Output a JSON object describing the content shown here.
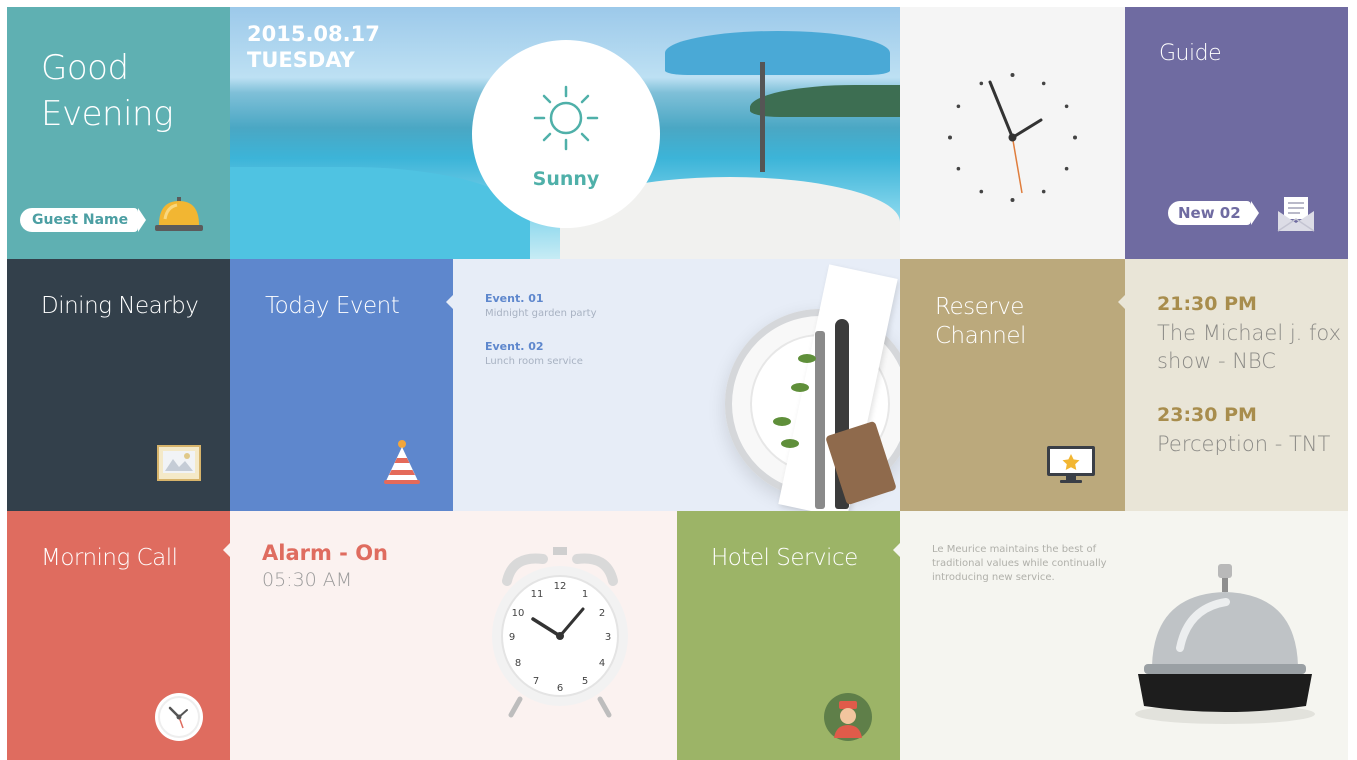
{
  "greeting": {
    "line1": "Good",
    "line2": "Evening",
    "guest_label": "Guest Name",
    "icon": "service-bell-icon"
  },
  "weather": {
    "date": "2015.08.17",
    "day": "TUESDAY",
    "condition": "Sunny",
    "icon": "sun-icon"
  },
  "clock": {
    "icon": "analog-clock-icon"
  },
  "guide": {
    "title": "Guide",
    "new_label": "New 02",
    "icon": "mail-envelope-icon"
  },
  "dining": {
    "title": "Dining Nearby",
    "icon": "map-picture-icon"
  },
  "today_event": {
    "title": "Today Event",
    "icon": "party-hat-icon",
    "events": [
      {
        "label": "Event. 01",
        "desc": "Midnight garden party"
      },
      {
        "label": "Event. 02",
        "desc": "Lunch room service"
      }
    ]
  },
  "reserve": {
    "title_line1": "Reserve",
    "title_line2": "Channel",
    "icon": "tv-star-icon"
  },
  "schedule": [
    {
      "time": "21:30 PM",
      "show": "The Michael j. fox show - NBC"
    },
    {
      "time": "23:30 PM",
      "show": "Perception - TNT"
    }
  ],
  "morning_call": {
    "title": "Morning Call",
    "icon": "wall-clock-icon"
  },
  "alarm": {
    "status": "Alarm - On",
    "time": "05:30 AM"
  },
  "hotel_service": {
    "title": "Hotel Service",
    "icon": "bellboy-icon",
    "description": "Le Meurice maintains the best of traditional values while continually introducing new service."
  },
  "colors": {
    "teal": "#5fb0b2",
    "navy": "#33404b",
    "blue": "#5e87cd",
    "purple": "#6f6ba1",
    "khaki": "#bba97c",
    "coral": "#df6c5f",
    "green": "#9cb467"
  }
}
